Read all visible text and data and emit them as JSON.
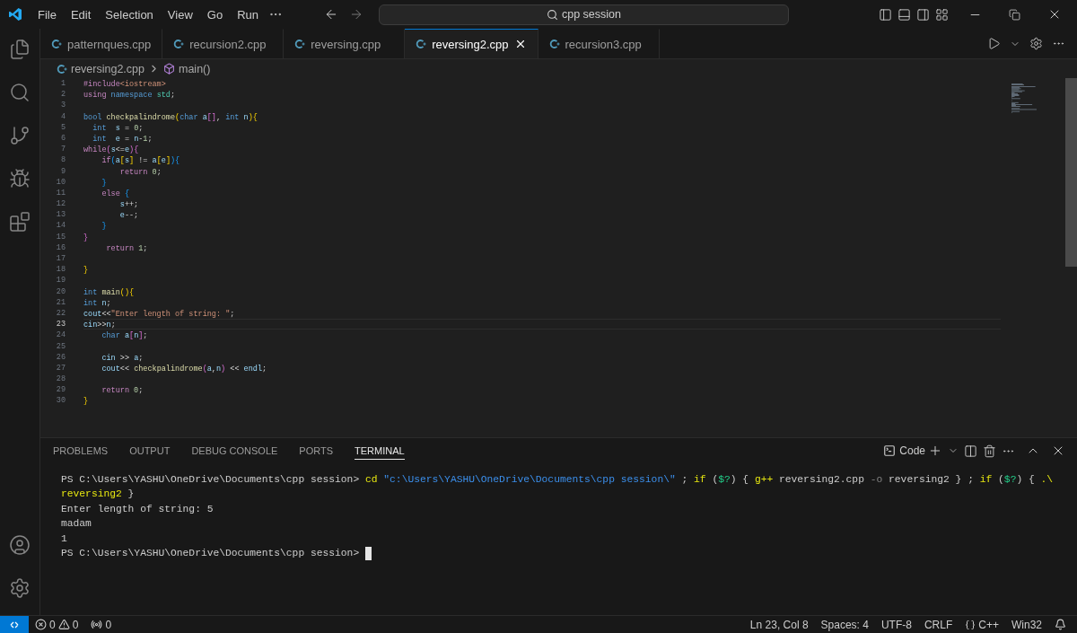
{
  "menu": [
    "File",
    "Edit",
    "Selection",
    "View",
    "Go",
    "Run"
  ],
  "search": {
    "value": "cpp session"
  },
  "tabs": [
    {
      "label": "patternques.cpp",
      "selected": false
    },
    {
      "label": "recursion2.cpp",
      "selected": false
    },
    {
      "label": "reversing.cpp",
      "selected": false
    },
    {
      "label": "reversing2.cpp",
      "selected": true
    },
    {
      "label": "recursion3.cpp",
      "selected": false
    }
  ],
  "breadcrumb": {
    "file": "reversing2.cpp",
    "symbol": "main()"
  },
  "editor": {
    "lines": [
      {
        "number": "1",
        "current": false,
        "tokens": [
          {
            "kind": "control",
            "text": "#include"
          },
          {
            "kind": "string",
            "text": "<iostream>"
          }
        ]
      },
      {
        "number": "2",
        "current": false,
        "tokens": [
          {
            "kind": "control",
            "text": "using "
          },
          {
            "kind": "keyword",
            "text": "namespace "
          },
          {
            "kind": "type",
            "text": "std"
          },
          {
            "kind": "plain",
            "text": ";"
          }
        ]
      },
      {
        "number": "3",
        "current": false
      },
      {
        "number": "4",
        "current": false,
        "tokens": [
          {
            "kind": "keyword",
            "text": "bool "
          },
          {
            "kind": "function",
            "text": "checkpalindrome"
          },
          {
            "kind": "bracket1",
            "text": "("
          },
          {
            "kind": "keyword",
            "text": "char "
          },
          {
            "kind": "variable",
            "text": "a"
          },
          {
            "kind": "bracket2",
            "text": "[]"
          },
          {
            "kind": "plain",
            "text": ", "
          },
          {
            "kind": "keyword",
            "text": "int "
          },
          {
            "kind": "variable",
            "text": "n"
          },
          {
            "kind": "bracket1",
            "text": "){"
          }
        ]
      },
      {
        "number": "5",
        "current": false,
        "tokens": [
          {
            "kind": "keyword",
            "text": "  int  "
          },
          {
            "kind": "variable",
            "text": "s"
          },
          {
            "kind": "plain",
            "text": " = "
          },
          {
            "kind": "number",
            "text": "0"
          },
          {
            "kind": "plain",
            "text": ";"
          }
        ]
      },
      {
        "number": "6",
        "current": false,
        "tokens": [
          {
            "kind": "keyword",
            "text": "  int  "
          },
          {
            "kind": "variable",
            "text": "e"
          },
          {
            "kind": "plain",
            "text": " = "
          },
          {
            "kind": "variable",
            "text": "n"
          },
          {
            "kind": "plain",
            "text": "-"
          },
          {
            "kind": "number",
            "text": "1"
          },
          {
            "kind": "plain",
            "text": ";"
          }
        ]
      },
      {
        "number": "7",
        "current": false,
        "tokens": [
          {
            "kind": "control",
            "text": "while"
          },
          {
            "kind": "bracket2",
            "text": "("
          },
          {
            "kind": "variable",
            "text": "s"
          },
          {
            "kind": "plain",
            "text": "<="
          },
          {
            "kind": "variable",
            "text": "e"
          },
          {
            "kind": "bracket2",
            "text": "){"
          }
        ]
      },
      {
        "number": "8",
        "current": false,
        "tokens": [
          {
            "kind": "control",
            "text": "    if"
          },
          {
            "kind": "bracket3",
            "text": "("
          },
          {
            "kind": "variable",
            "text": "a"
          },
          {
            "kind": "bracket1",
            "text": "["
          },
          {
            "kind": "variable",
            "text": "s"
          },
          {
            "kind": "bracket1",
            "text": "]"
          },
          {
            "kind": "plain",
            "text": " != "
          },
          {
            "kind": "variable",
            "text": "a"
          },
          {
            "kind": "bracket1",
            "text": "["
          },
          {
            "kind": "variable",
            "text": "e"
          },
          {
            "kind": "bracket1",
            "text": "]"
          },
          {
            "kind": "bracket3",
            "text": "){"
          }
        ]
      },
      {
        "number": "9",
        "current": false,
        "tokens": [
          {
            "kind": "control",
            "text": "        return "
          },
          {
            "kind": "number",
            "text": "0"
          },
          {
            "kind": "plain",
            "text": ";"
          }
        ]
      },
      {
        "number": "10",
        "current": false,
        "tokens": [
          {
            "kind": "bracket3",
            "text": "    }"
          }
        ]
      },
      {
        "number": "11",
        "current": false,
        "tokens": [
          {
            "kind": "control",
            "text": "    else "
          },
          {
            "kind": "bracket3",
            "text": "{"
          }
        ]
      },
      {
        "number": "12",
        "current": false,
        "tokens": [
          {
            "kind": "variable",
            "text": "        s"
          },
          {
            "kind": "plain",
            "text": "++;"
          }
        ]
      },
      {
        "number": "13",
        "current": false,
        "tokens": [
          {
            "kind": "variable",
            "text": "        e"
          },
          {
            "kind": "plain",
            "text": "--;"
          }
        ]
      },
      {
        "number": "14",
        "current": false,
        "tokens": [
          {
            "kind": "bracket3",
            "text": "    }"
          }
        ]
      },
      {
        "number": "15",
        "current": false,
        "tokens": [
          {
            "kind": "bracket2",
            "text": "}"
          }
        ]
      },
      {
        "number": "16",
        "current": false,
        "tokens": [
          {
            "kind": "control",
            "text": "     return "
          },
          {
            "kind": "number",
            "text": "1"
          },
          {
            "kind": "plain",
            "text": ";"
          }
        ]
      },
      {
        "number": "17",
        "current": false
      },
      {
        "number": "18",
        "current": false,
        "tokens": [
          {
            "kind": "bracket1",
            "text": "}"
          }
        ]
      },
      {
        "number": "19",
        "current": false
      },
      {
        "number": "20",
        "current": false,
        "tokens": [
          {
            "kind": "keyword",
            "text": "int "
          },
          {
            "kind": "function",
            "text": "main"
          },
          {
            "kind": "bracket1",
            "text": "(){"
          }
        ]
      },
      {
        "number": "21",
        "current": false,
        "tokens": [
          {
            "kind": "keyword",
            "text": "int "
          },
          {
            "kind": "variable",
            "text": "n"
          },
          {
            "kind": "plain",
            "text": ";"
          }
        ]
      },
      {
        "number": "22",
        "current": false,
        "tokens": [
          {
            "kind": "variable",
            "text": "cout"
          },
          {
            "kind": "plain",
            "text": "<<"
          },
          {
            "kind": "string",
            "text": "\"Enter length of string: \""
          },
          {
            "kind": "plain",
            "text": ";"
          }
        ]
      },
      {
        "number": "23",
        "current": true,
        "tokens": [
          {
            "kind": "variable",
            "text": "cin"
          },
          {
            "kind": "plain",
            "text": ">>"
          },
          {
            "kind": "variable",
            "text": "n"
          },
          {
            "kind": "plain",
            "text": ";"
          }
        ]
      },
      {
        "number": "24",
        "current": false,
        "tokens": [
          {
            "kind": "keyword",
            "text": "    char "
          },
          {
            "kind": "variable",
            "text": "a"
          },
          {
            "kind": "bracket2",
            "text": "["
          },
          {
            "kind": "variable",
            "text": "n"
          },
          {
            "kind": "bracket2",
            "text": "]"
          },
          {
            "kind": "plain",
            "text": ";"
          }
        ]
      },
      {
        "number": "25",
        "current": false
      },
      {
        "number": "26",
        "current": false,
        "tokens": [
          {
            "kind": "variable",
            "text": "    cin"
          },
          {
            "kind": "plain",
            "text": " >> "
          },
          {
            "kind": "variable",
            "text": "a"
          },
          {
            "kind": "plain",
            "text": ";"
          }
        ]
      },
      {
        "number": "27",
        "current": false,
        "tokens": [
          {
            "kind": "variable",
            "text": "    cout"
          },
          {
            "kind": "plain",
            "text": "<< "
          },
          {
            "kind": "function",
            "text": "checkpalindrome"
          },
          {
            "kind": "bracket2",
            "text": "("
          },
          {
            "kind": "variable",
            "text": "a"
          },
          {
            "kind": "plain",
            "text": ","
          },
          {
            "kind": "variable",
            "text": "n"
          },
          {
            "kind": "bracket2",
            "text": ")"
          },
          {
            "kind": "plain",
            "text": " << "
          },
          {
            "kind": "variable",
            "text": "endl"
          },
          {
            "kind": "plain",
            "text": ";"
          }
        ]
      },
      {
        "number": "28",
        "current": false
      },
      {
        "number": "29",
        "current": false,
        "tokens": [
          {
            "kind": "control",
            "text": "    return "
          },
          {
            "kind": "number",
            "text": "0"
          },
          {
            "kind": "plain",
            "text": ";"
          }
        ]
      },
      {
        "number": "30",
        "current": false,
        "tokens": [
          {
            "kind": "bracket1",
            "text": "}"
          }
        ]
      }
    ]
  },
  "panel": {
    "tabs": [
      {
        "label": "PROBLEMS",
        "selected": false
      },
      {
        "label": "OUTPUT",
        "selected": false
      },
      {
        "label": "DEBUG CONSOLE",
        "selected": false
      },
      {
        "label": "PORTS",
        "selected": false
      },
      {
        "label": "TERMINAL",
        "selected": true
      }
    ],
    "profile": "Code",
    "lines": [
      {
        "tokens": [
          {
            "kind": "plain",
            "text": "PS C:\\Users\\YASHU\\OneDrive\\Documents\\cpp session> "
          },
          {
            "kind": "command",
            "text": "cd "
          },
          {
            "kind": "string",
            "text": "\"c:\\Users\\YASHU\\OneDrive\\Documents\\cpp session\\\""
          },
          {
            "kind": "plain",
            "text": " ; "
          },
          {
            "kind": "command",
            "text": "if "
          },
          {
            "kind": "plain",
            "text": "("
          },
          {
            "kind": "variable",
            "text": "$?"
          },
          {
            "kind": "plain",
            "text": ") { "
          },
          {
            "kind": "command",
            "text": "g++ "
          },
          {
            "kind": "plain",
            "text": "reversing2.cpp "
          },
          {
            "kind": "option",
            "text": "-o"
          },
          {
            "kind": "plain",
            "text": " reversing2 } ; "
          },
          {
            "kind": "command",
            "text": "if "
          },
          {
            "kind": "plain",
            "text": "("
          },
          {
            "kind": "variable",
            "text": "$?"
          },
          {
            "kind": "plain",
            "text": ") { "
          },
          {
            "kind": "command",
            "text": ".\\"
          }
        ]
      },
      {
        "tokens": [
          {
            "kind": "command",
            "text": "reversing2 "
          },
          {
            "kind": "plain",
            "text": "}"
          }
        ]
      },
      {
        "tokens": [
          {
            "kind": "plain",
            "text": "Enter length of string: 5"
          }
        ]
      },
      {
        "tokens": [
          {
            "kind": "plain",
            "text": "madam"
          }
        ]
      },
      {
        "tokens": [
          {
            "kind": "plain",
            "text": "1"
          }
        ]
      },
      {
        "cursor": true,
        "tokens": [
          {
            "kind": "plain",
            "text": "PS C:\\Users\\YASHU\\OneDrive\\Documents\\cpp session> "
          }
        ]
      }
    ]
  },
  "status_bar": {
    "errors": "0",
    "warnings": "0",
    "ports": "0",
    "items": [
      {
        "kind": "text",
        "label": "Ln 23, Col 8"
      },
      {
        "kind": "text",
        "label": "Spaces: 4"
      },
      {
        "kind": "text",
        "label": "UTF-8"
      },
      {
        "kind": "text",
        "label": "CRLF"
      },
      {
        "kind": "language",
        "label": "C++"
      },
      {
        "kind": "text",
        "label": "Win32"
      }
    ]
  }
}
